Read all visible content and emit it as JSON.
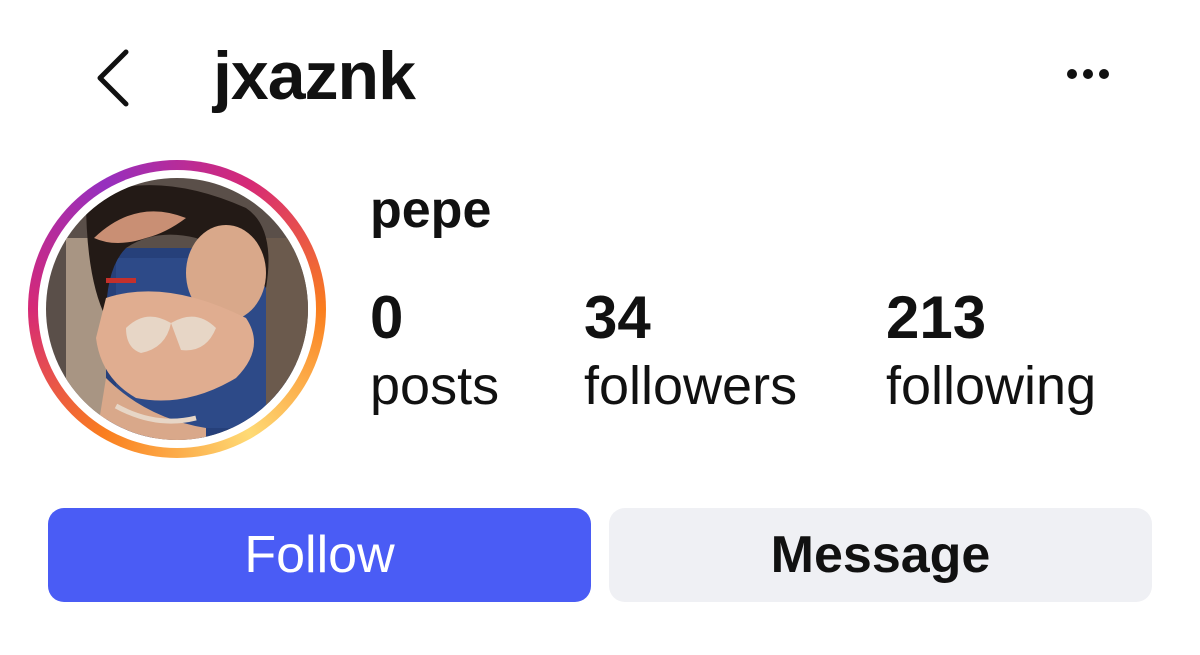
{
  "header": {
    "back_icon": "chevron-left-icon",
    "username": "jxaznk",
    "more_icon": "more-horizontal-icon"
  },
  "profile": {
    "avatar": "profile-photo",
    "story_ring_colors": [
      "#d62976",
      "#fa7e1e",
      "#feda75",
      "#962fbf"
    ],
    "display_name": "pepe",
    "stats": {
      "posts": {
        "count": "0",
        "label": "posts"
      },
      "followers": {
        "count": "34",
        "label": "followers"
      },
      "following": {
        "count": "213",
        "label": "following"
      }
    }
  },
  "actions": {
    "follow_label": "Follow",
    "follow_color": "#4a5cf5",
    "message_label": "Message",
    "message_color": "#eff0f4"
  }
}
